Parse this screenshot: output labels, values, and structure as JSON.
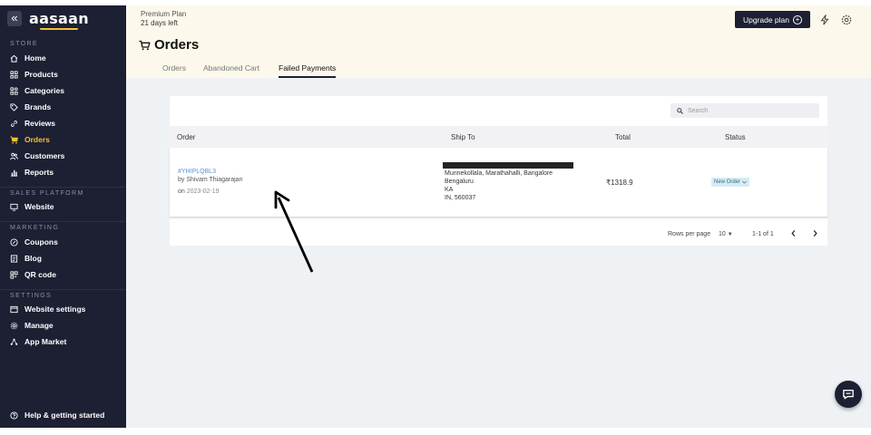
{
  "app": {
    "logo": "aasaan",
    "collapse_glyph": "«"
  },
  "sidebar": {
    "sections": {
      "store": "STORE",
      "sales_platform": "SALES PLATFORM",
      "marketing": "MARKETING",
      "settings": "SETTINGS"
    },
    "items": [
      {
        "label": "Home",
        "icon": "home-icon"
      },
      {
        "label": "Products",
        "icon": "grid-icon"
      },
      {
        "label": "Categories",
        "icon": "categories-icon"
      },
      {
        "label": "Brands",
        "icon": "tag-icon"
      },
      {
        "label": "Reviews",
        "icon": "link-icon"
      },
      {
        "label": "Orders",
        "icon": "cart-icon",
        "active": true
      },
      {
        "label": "Customers",
        "icon": "users-icon"
      },
      {
        "label": "Reports",
        "icon": "bar-chart-icon"
      },
      {
        "label": "Website",
        "icon": "monitor-icon"
      },
      {
        "label": "Coupons",
        "icon": "coupon-icon"
      },
      {
        "label": "Blog",
        "icon": "document-icon"
      },
      {
        "label": "QR code",
        "icon": "qr-icon"
      },
      {
        "label": "Website settings",
        "icon": "browser-icon"
      },
      {
        "label": "Manage",
        "icon": "gear-icon"
      },
      {
        "label": "App Market",
        "icon": "apps-icon"
      }
    ],
    "help": "Help & getting started"
  },
  "header": {
    "plan_name": "Premium Plan",
    "plan_days": "21 days left",
    "upgrade_label": "Upgrade plan",
    "page_title": "Orders",
    "tabs": [
      {
        "label": "Orders"
      },
      {
        "label": "Abandoned Cart"
      },
      {
        "label": "Failed Payments",
        "active": true
      }
    ]
  },
  "table": {
    "search_placeholder": "Search",
    "columns": [
      "Order",
      "Ship To",
      "Total",
      "Status"
    ],
    "rows": [
      {
        "order_id": "#YHIPLQBL3",
        "by": "by Shivam Thiagarajan",
        "on_prefix": "on",
        "date": "2023-02-19",
        "address": [
          "Munnekollala, Marathahalli, Bangalore",
          "Bengaluru",
          "KA",
          "IN, 560037"
        ],
        "total": "₹1318.9",
        "status": "New Order"
      }
    ],
    "pagination": {
      "rows_per_page_label": "Rows per page",
      "rows_per_page": "10",
      "range": "1-1 of 1"
    }
  },
  "colors": {
    "sidebar_bg": "#1d1f33",
    "accent": "#f2c230",
    "header_bg": "#fdf8ec",
    "main_bg": "#eff2f5",
    "link": "#5c8ed6"
  }
}
